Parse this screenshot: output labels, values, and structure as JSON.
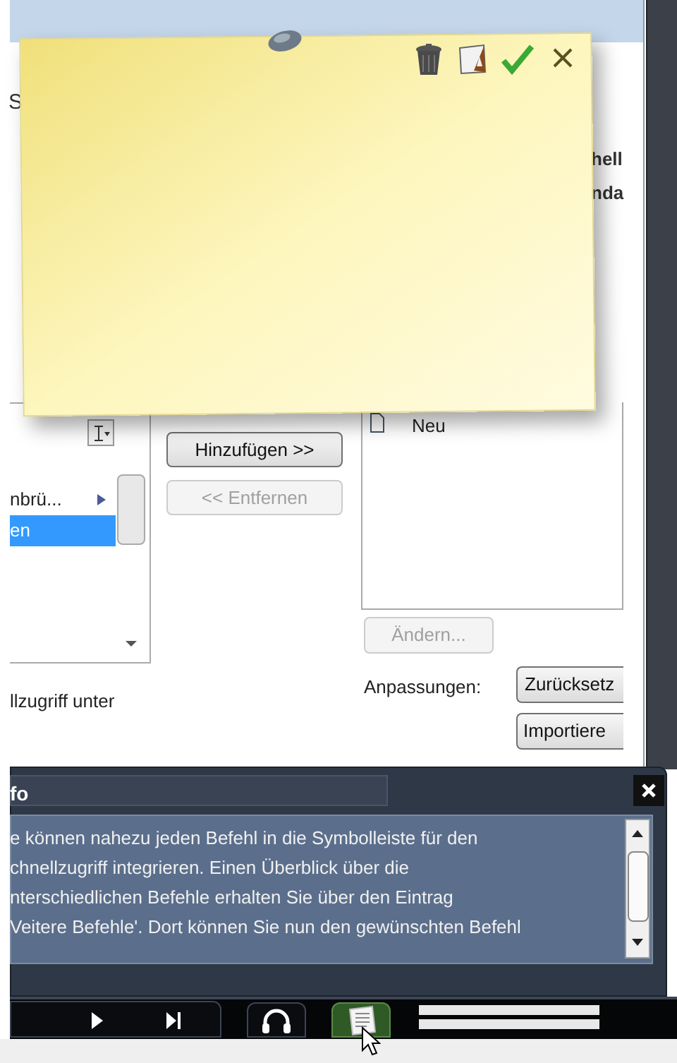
{
  "dialog": {
    "fragments": [
      "S",
      "hell",
      "nda"
    ],
    "left_list": {
      "items": [
        {
          "label": "nbrü...",
          "submenu": true,
          "selected": false
        },
        {
          "label": "en",
          "submenu": false,
          "selected": true
        }
      ]
    },
    "buttons": [
      {
        "label": "Hinzufügen >>",
        "disabled": false
      },
      {
        "label": "<< Entfernen",
        "disabled": true
      }
    ],
    "right_list": {
      "items": [
        {
          "label": "Neu"
        }
      ]
    },
    "modify_button": {
      "label": "Ändern...",
      "disabled": true
    },
    "customizations_label": "Anpassungen:",
    "reset_button": {
      "label": "Zurücksetz"
    },
    "import_button": {
      "label": "Importiere"
    },
    "checkbox_label": "llzugriff unter"
  },
  "info_panel": {
    "title": "fo",
    "lines": [
      "e können nahezu jeden Befehl in die Symbolleiste für den",
      "chnellzugriff integrieren. Einen Überblick über die",
      "nterschiedlichen Befehle erhalten Sie über den Eintrag",
      "Veitere Befehle'. Dort können Sie nun den gewünschten Befehl"
    ]
  },
  "player": {
    "buttons": [
      {
        "kind": "play",
        "active": false
      },
      {
        "kind": "next",
        "active": false
      },
      {
        "kind": "headphones",
        "active": false
      },
      {
        "kind": "notes",
        "active": true
      }
    ],
    "bars": [
      {
        "level": 1
      },
      {
        "level": 1
      }
    ]
  }
}
